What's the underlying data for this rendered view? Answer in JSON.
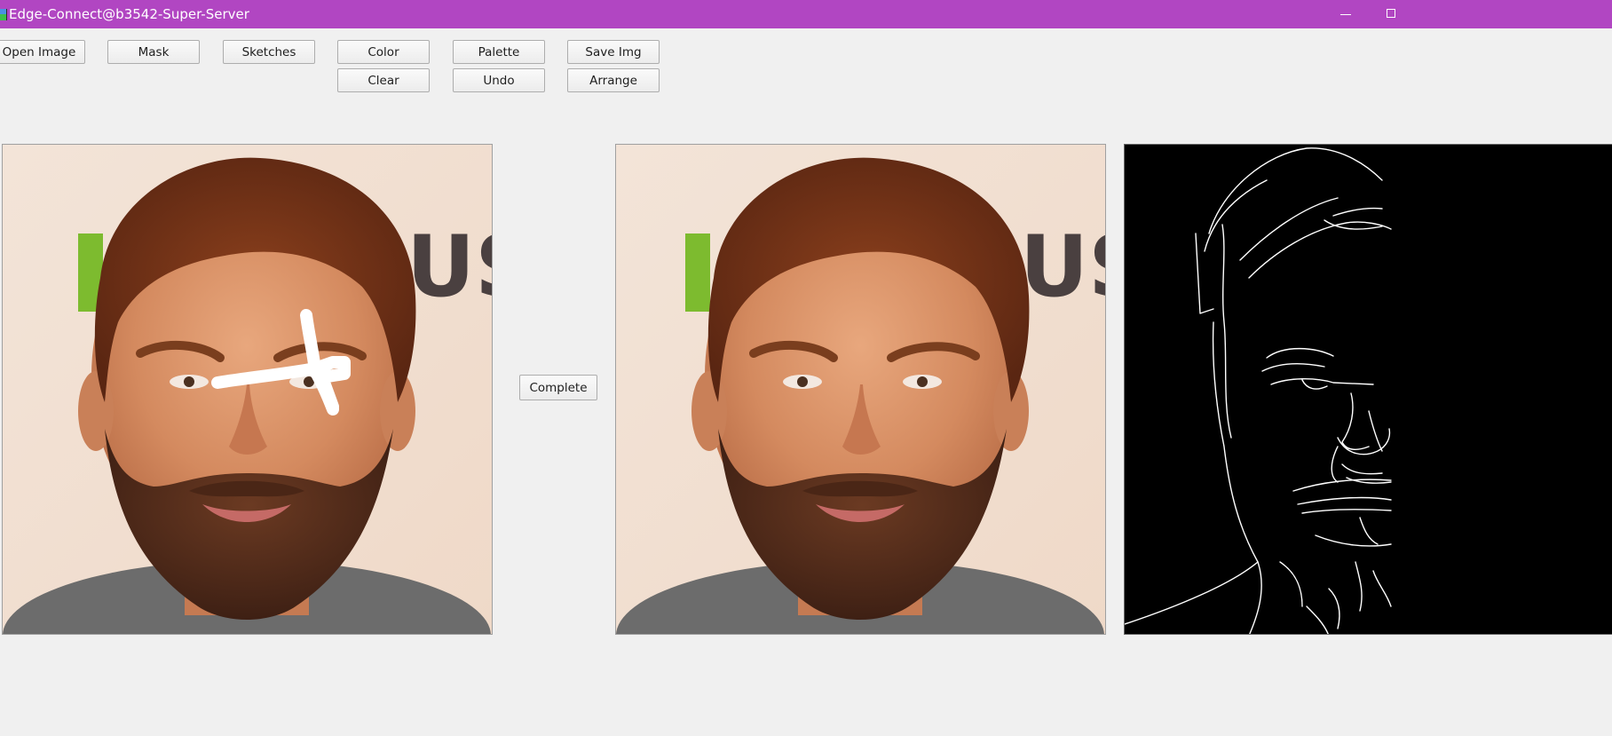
{
  "window": {
    "title": "Edge-Connect@b3542-Super-Server",
    "title_bar_color": "#b146c2",
    "controls": [
      "minimize-icon",
      "maximize-icon"
    ]
  },
  "toolbar": {
    "open_image": "Open Image",
    "mask": "Mask",
    "sketches": "Sketches",
    "color": "Color",
    "palette": "Palette",
    "save_img": "Save Img",
    "clear": "Clear",
    "undo": "Undo",
    "arrange": "Arrange"
  },
  "complete_button": "Complete",
  "panels": {
    "input": {
      "content": "portrait with white mask strokes",
      "mask_color": "#ffffff"
    },
    "output": {
      "content": "inpainted portrait"
    },
    "edges": {
      "content": "edge map",
      "background": "#000000",
      "stroke": "#ffffff"
    }
  }
}
